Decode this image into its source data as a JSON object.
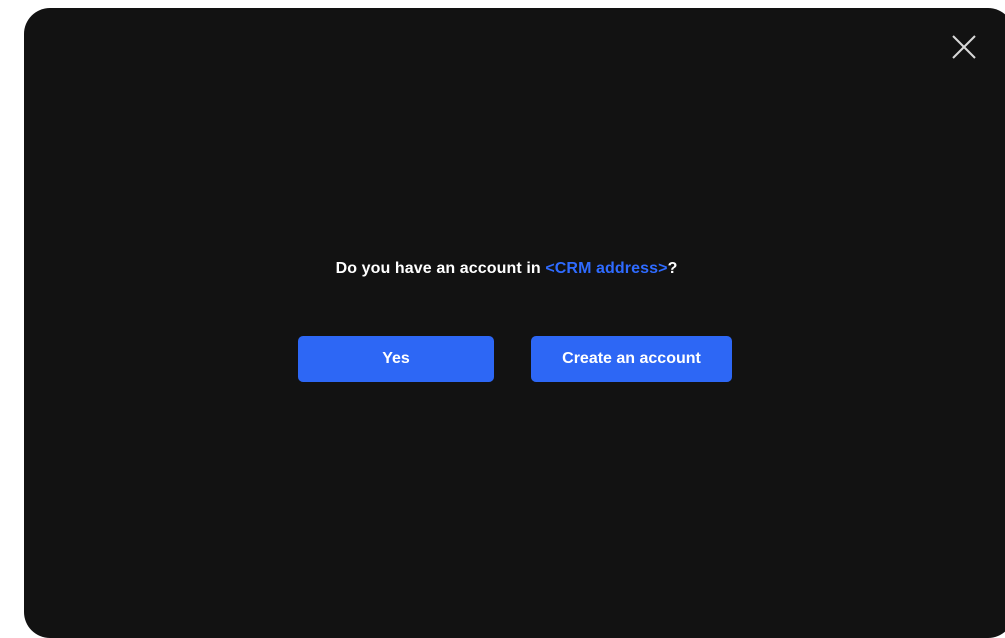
{
  "dialog": {
    "close_icon": "close-icon",
    "question": {
      "prefix": "Do you have an account in ",
      "crm_address": "<CRM address>",
      "suffix": "?"
    },
    "yes_label": "Yes",
    "create_account_label": "Create an account"
  },
  "colors": {
    "background": "#121212",
    "accent": "#2d67f5",
    "link": "#2f6bff",
    "text": "#ffffff"
  }
}
